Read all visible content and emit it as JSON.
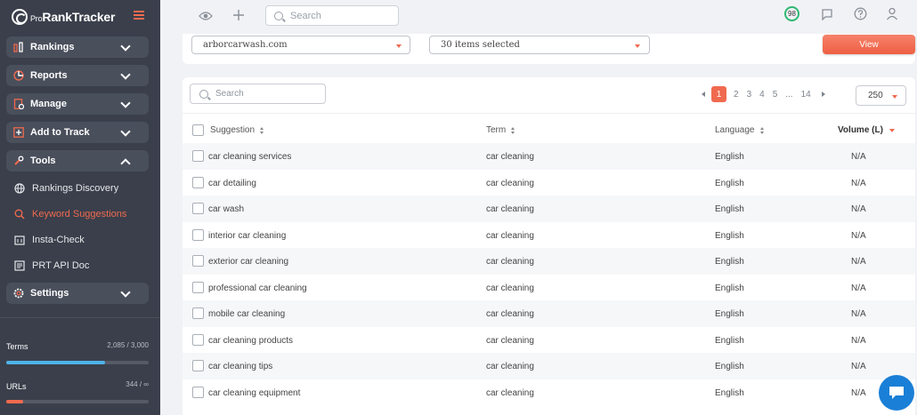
{
  "app": {
    "logo_text": "RankTracker",
    "logo_prefix": "Pro"
  },
  "sidebar": {
    "sections": [
      {
        "label": "Rankings",
        "expanded": false
      },
      {
        "label": "Reports",
        "expanded": false
      },
      {
        "label": "Manage",
        "expanded": false
      },
      {
        "label": "Add to Track",
        "expanded": false
      },
      {
        "label": "Tools",
        "expanded": true
      }
    ],
    "tools_items": [
      {
        "label": "Rankings Discovery",
        "active": false
      },
      {
        "label": "Keyword Suggestions",
        "active": true
      },
      {
        "label": "Insta-Check",
        "active": false
      },
      {
        "label": "PRT API Doc",
        "active": false
      }
    ],
    "settings_label": "Settings",
    "usage": [
      {
        "label": "Terms",
        "value": "2,085 / 3,000",
        "fraction": 0.695,
        "color": "#4fb3e8"
      },
      {
        "label": "URLs",
        "value": "344 / ∞",
        "fraction": 0.12,
        "color": "#f06a4f"
      }
    ]
  },
  "topbar": {
    "search_placeholder": "Search",
    "score": "98"
  },
  "filters": {
    "domain": "arborcarwash.com",
    "items_selected": "30 items selected",
    "view_label": "View"
  },
  "table": {
    "search_placeholder": "Search",
    "pagination": {
      "current": "1",
      "pages": [
        "2",
        "3",
        "4",
        "5"
      ],
      "ellipsis": "...",
      "last": "14"
    },
    "per_page": "250",
    "headers": {
      "suggestion": "Suggestion",
      "term": "Term",
      "language": "Language",
      "volume": "Volume (L)"
    },
    "rows": [
      {
        "suggestion": "car cleaning services",
        "term": "car cleaning",
        "language": "English",
        "volume": "N/A"
      },
      {
        "suggestion": "car detailing",
        "term": "car cleaning",
        "language": "English",
        "volume": "N/A"
      },
      {
        "suggestion": "car wash",
        "term": "car cleaning",
        "language": "English",
        "volume": "N/A"
      },
      {
        "suggestion": "interior car cleaning",
        "term": "car cleaning",
        "language": "English",
        "volume": "N/A"
      },
      {
        "suggestion": "exterior car cleaning",
        "term": "car cleaning",
        "language": "English",
        "volume": "N/A"
      },
      {
        "suggestion": "professional car cleaning",
        "term": "car cleaning",
        "language": "English",
        "volume": "N/A"
      },
      {
        "suggestion": "mobile car cleaning",
        "term": "car cleaning",
        "language": "English",
        "volume": "N/A"
      },
      {
        "suggestion": "car cleaning products",
        "term": "car cleaning",
        "language": "English",
        "volume": "N/A"
      },
      {
        "suggestion": "car cleaning tips",
        "term": "car cleaning",
        "language": "English",
        "volume": "N/A"
      },
      {
        "suggestion": "car cleaning equipment",
        "term": "car cleaning",
        "language": "English",
        "volume": "N/A"
      }
    ]
  }
}
